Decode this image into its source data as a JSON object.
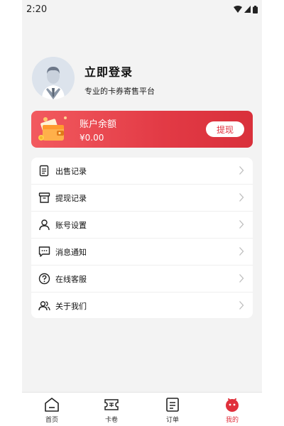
{
  "status": {
    "time": "2:20"
  },
  "profile": {
    "title": "立即登录",
    "subtitle": "专业的卡券寄售平台"
  },
  "balance": {
    "title": "账户余额",
    "amount": "¥0.00",
    "withdraw_label": "提现"
  },
  "menu": {
    "items": [
      {
        "label": "出售记录",
        "icon": "document-icon"
      },
      {
        "label": "提现记录",
        "icon": "archive-icon"
      },
      {
        "label": "账号设置",
        "icon": "user-icon"
      },
      {
        "label": "消息通知",
        "icon": "message-icon"
      },
      {
        "label": "在线客服",
        "icon": "help-circle-icon"
      },
      {
        "label": "关于我们",
        "icon": "users-icon"
      }
    ]
  },
  "tabbar": {
    "tabs": [
      {
        "label": "首页",
        "icon": "home-icon"
      },
      {
        "label": "卡卷",
        "icon": "ticket-icon"
      },
      {
        "label": "订单",
        "icon": "order-icon"
      },
      {
        "label": "我的",
        "icon": "profile-icon",
        "active": true
      }
    ]
  },
  "colors": {
    "accent": "#e0303c",
    "background": "#f3f3f3"
  }
}
